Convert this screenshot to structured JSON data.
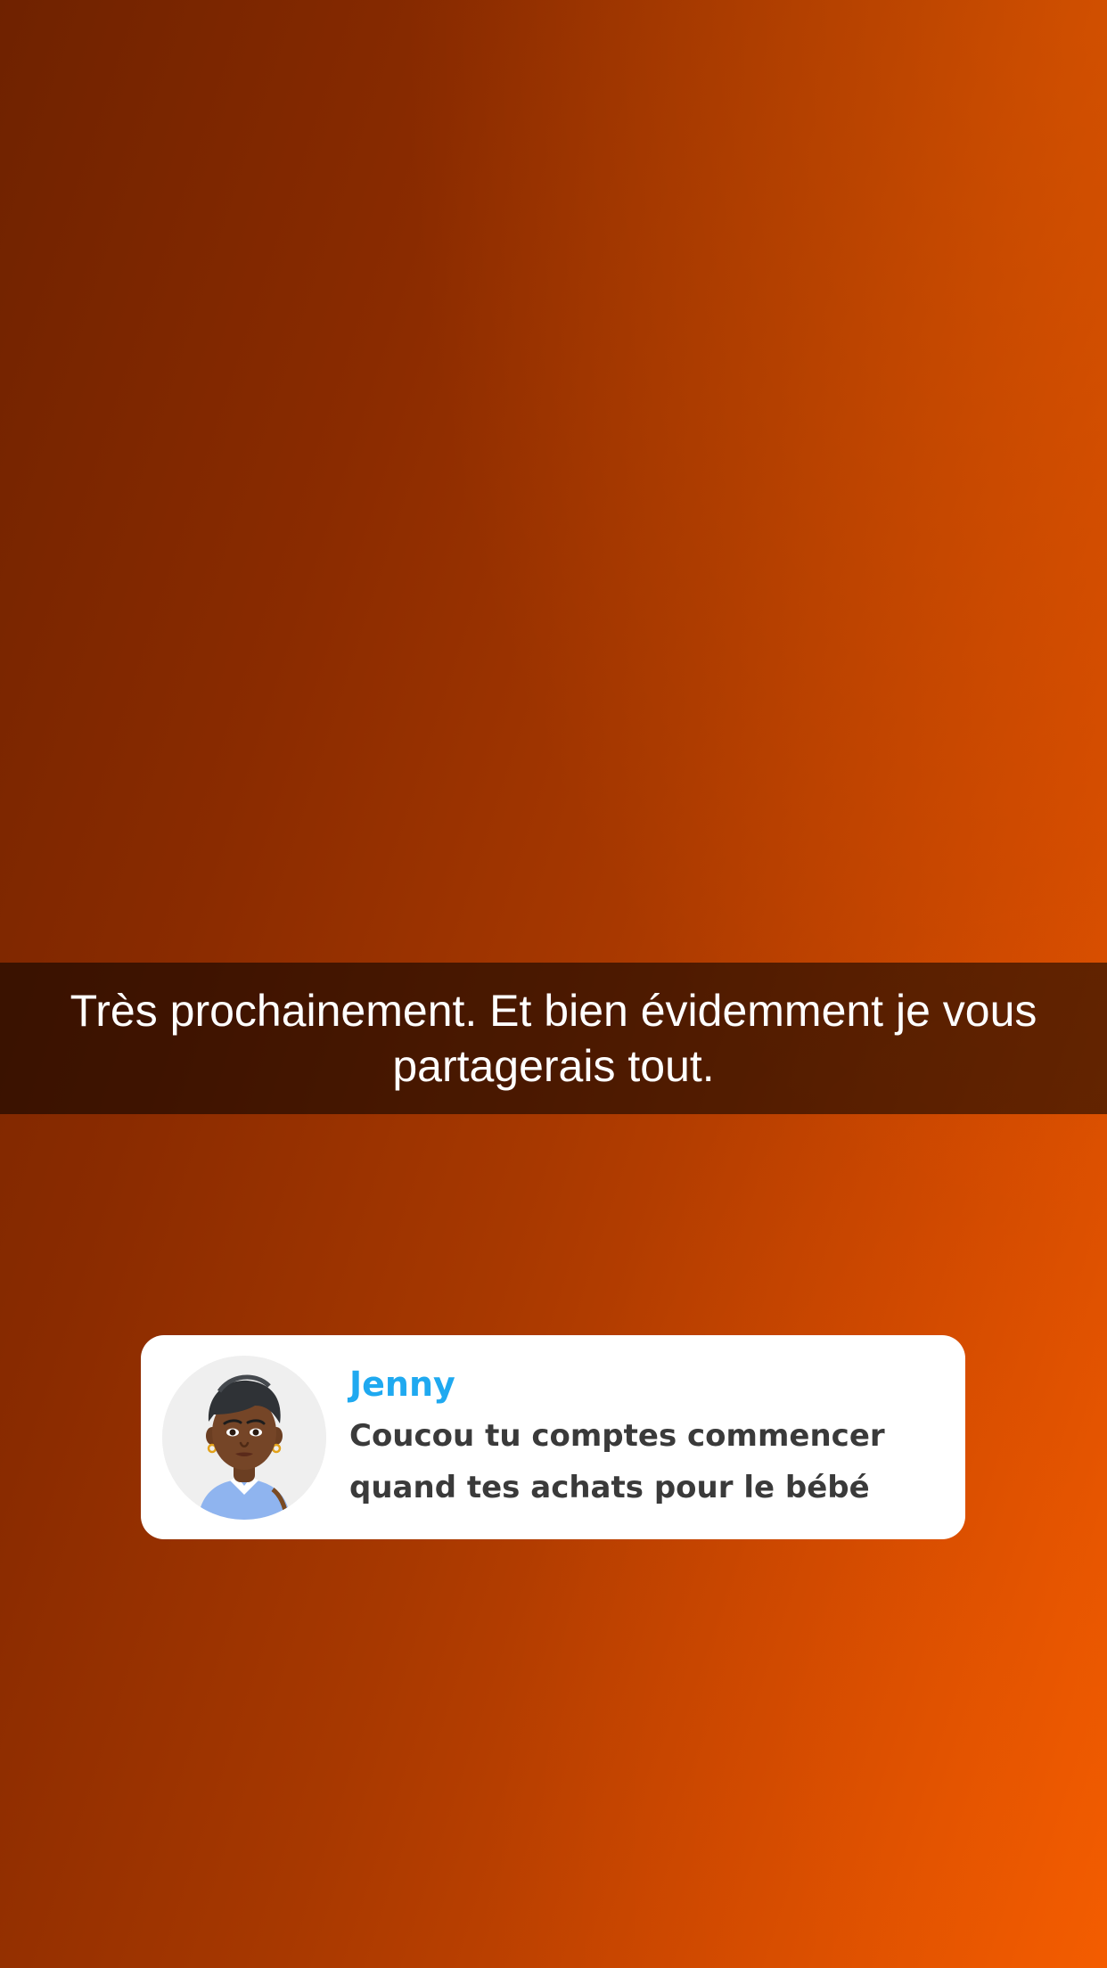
{
  "caption": {
    "text": "Très prochainement. Et bien évidemment je vous partagerais tout."
  },
  "reply_card": {
    "sender_name": "Jenny",
    "message": "Coucou tu comptes commencer quand tes achats pour le bébé",
    "avatar_icon": "bitmoji-avatar-icon"
  },
  "colors": {
    "background_start": "#6f2200",
    "background_end": "#f05a00",
    "sender_name": "#1fa9f0",
    "message_text": "#3a3a3a",
    "card_background": "#ffffff"
  }
}
